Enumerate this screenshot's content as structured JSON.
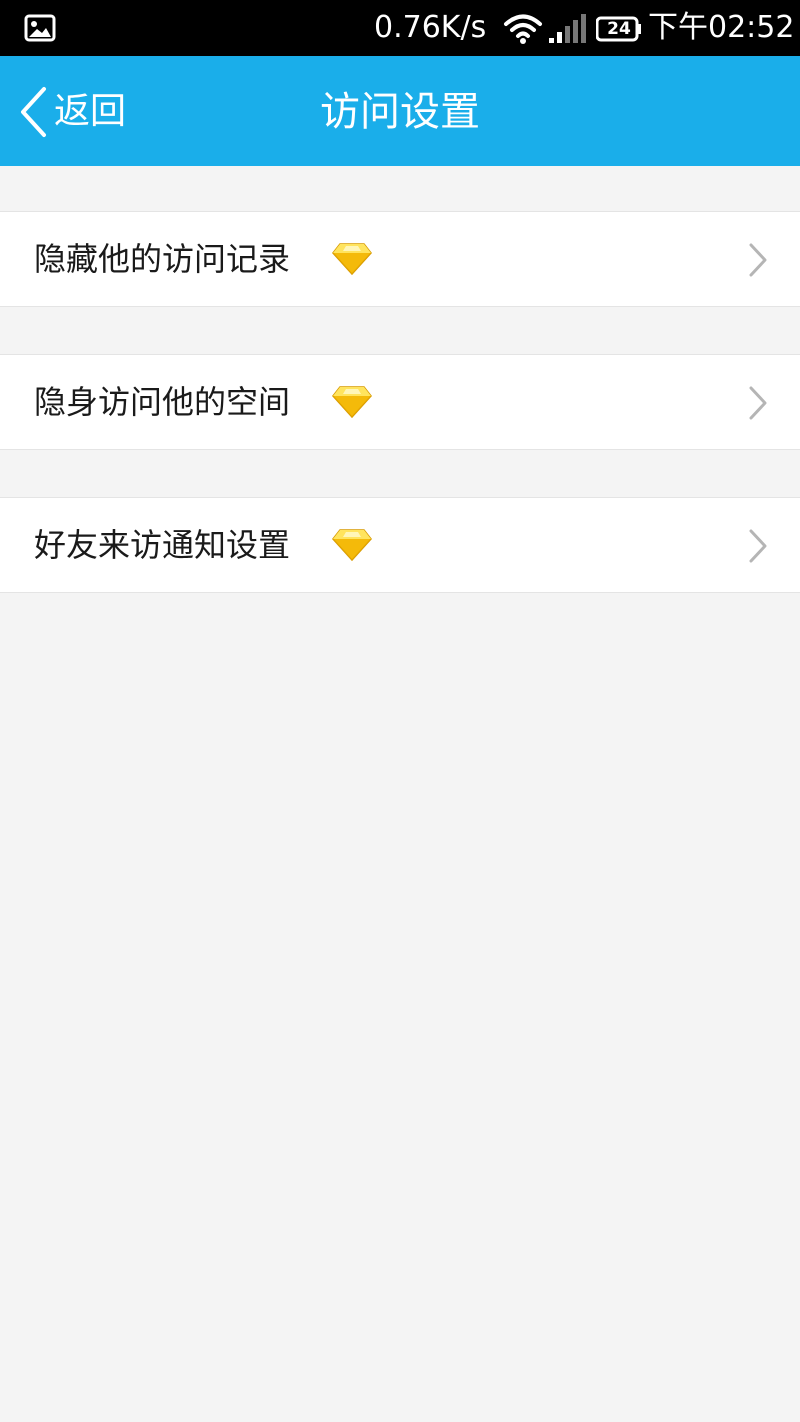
{
  "status_bar": {
    "net_speed": "0.76K/s",
    "battery_level": "24",
    "time": "下午02:52",
    "icons": [
      "image-icon",
      "wifi-icon",
      "signal-icon",
      "battery-icon"
    ]
  },
  "header": {
    "back_label": "返回",
    "title": "访问设置",
    "background_color": "#1aaeea"
  },
  "settings": {
    "items": [
      {
        "label": "隐藏他的访问记录",
        "icon": "diamond-icon",
        "arrow": "chevron-right-icon"
      },
      {
        "label": "隐身访问他的空间",
        "icon": "diamond-icon",
        "arrow": "chevron-right-icon"
      },
      {
        "label": "好友来访通知设置",
        "icon": "diamond-icon",
        "arrow": "chevron-right-icon"
      }
    ]
  }
}
